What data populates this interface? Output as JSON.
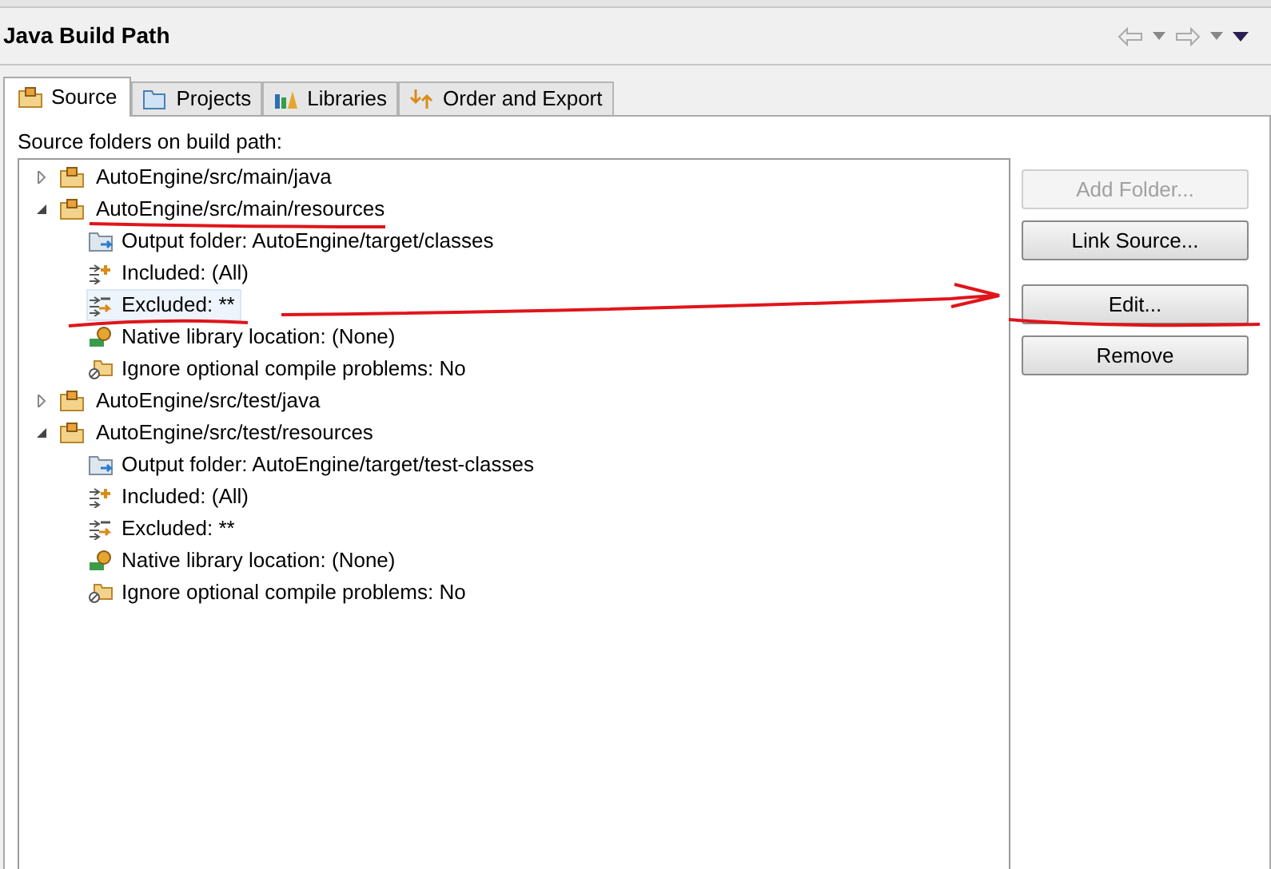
{
  "header": {
    "title": "Java Build Path"
  },
  "tabs": [
    {
      "label": "Source",
      "kind": "source",
      "selected": true
    },
    {
      "label": "Projects",
      "kind": "projects",
      "selected": false
    },
    {
      "label": "Libraries",
      "kind": "libraries",
      "selected": false
    },
    {
      "label": "Order and Export",
      "kind": "order",
      "selected": false
    }
  ],
  "panel": {
    "label": "Source folders on build path:"
  },
  "tree": [
    {
      "label": "AutoEngine/src/main/java",
      "expanded": false,
      "selected": false
    },
    {
      "label": "AutoEngine/src/main/resources",
      "expanded": true,
      "selected": false,
      "children": [
        {
          "label": "Output folder: AutoEngine/target/classes",
          "kind": "output",
          "selected": false
        },
        {
          "label": "Included: (All)",
          "kind": "included",
          "selected": false
        },
        {
          "label": "Excluded: **",
          "kind": "excluded",
          "selected": true
        },
        {
          "label": "Native library location: (None)",
          "kind": "native",
          "selected": false
        },
        {
          "label": "Ignore optional compile problems: No",
          "kind": "ignore",
          "selected": false
        }
      ]
    },
    {
      "label": "AutoEngine/src/test/java",
      "expanded": false,
      "selected": false
    },
    {
      "label": "AutoEngine/src/test/resources",
      "expanded": true,
      "selected": false,
      "children": [
        {
          "label": "Output folder: AutoEngine/target/test-classes",
          "kind": "output",
          "selected": false
        },
        {
          "label": "Included: (All)",
          "kind": "included",
          "selected": false
        },
        {
          "label": "Excluded: **",
          "kind": "excluded",
          "selected": false
        },
        {
          "label": "Native library location: (None)",
          "kind": "native",
          "selected": false
        },
        {
          "label": "Ignore optional compile problems: No",
          "kind": "ignore",
          "selected": false
        }
      ]
    }
  ],
  "button_groups": [
    [
      {
        "label": "Add Folder...",
        "disabled": true
      },
      {
        "label": "Link Source...",
        "disabled": false
      }
    ],
    [
      {
        "label": "Edit...",
        "disabled": false
      },
      {
        "label": "Remove",
        "disabled": false
      }
    ]
  ]
}
